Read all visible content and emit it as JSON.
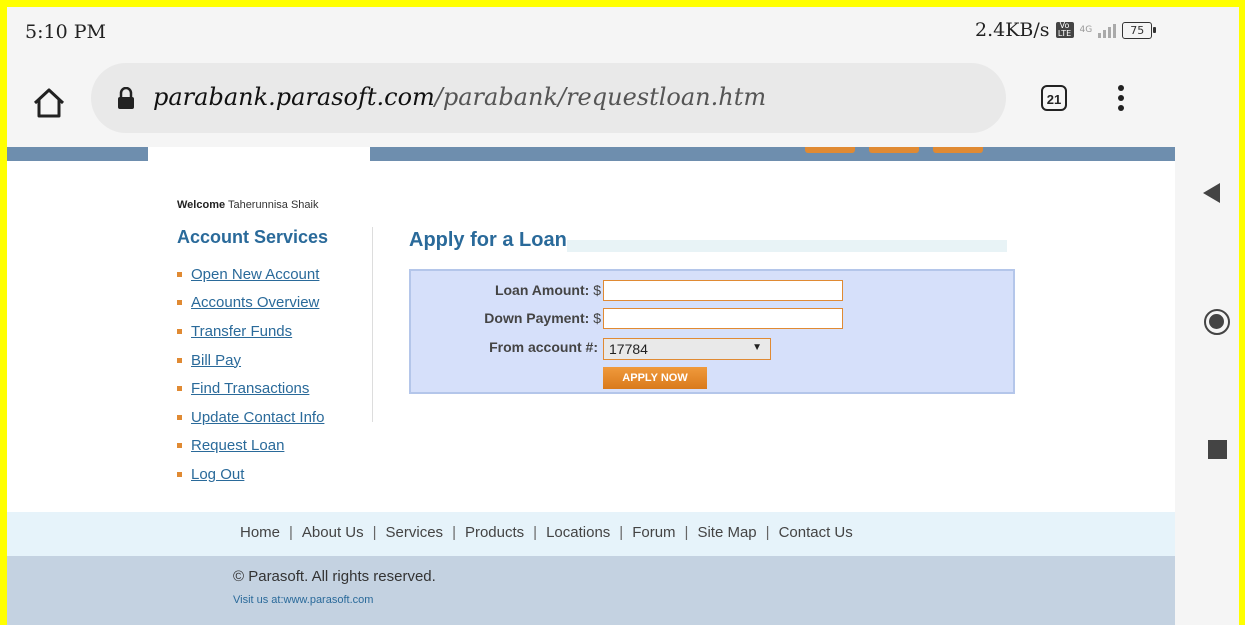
{
  "status_bar": {
    "time": "5:10 PM",
    "network_speed": "2.4KB/s",
    "volte": "Vo LTE",
    "signal_label": "4G",
    "battery": "75"
  },
  "browser": {
    "url_host": "parabank.parasoft.com",
    "url_path": "/parabank/requestloan.htm",
    "tab_count": "21"
  },
  "sidebar": {
    "welcome_prefix": "Welcome",
    "user_name": "Taherunnisa Shaik",
    "title": "Account Services",
    "items": [
      {
        "label": "Open New Account"
      },
      {
        "label": "Accounts Overview"
      },
      {
        "label": "Transfer Funds"
      },
      {
        "label": "Bill Pay"
      },
      {
        "label": "Find Transactions"
      },
      {
        "label": "Update Contact Info"
      },
      {
        "label": "Request Loan"
      },
      {
        "label": "Log Out"
      }
    ]
  },
  "main": {
    "title": "Apply for a Loan",
    "form": {
      "loan_amount_label": "Loan Amount:",
      "down_payment_label": "Down Payment:",
      "currency": "$",
      "from_account_label": "From account #:",
      "loan_amount_value": "",
      "down_payment_value": "",
      "from_account_value": "17784",
      "apply_label": "APPLY NOW"
    }
  },
  "footer": {
    "links": [
      "Home",
      "About Us",
      "Services",
      "Products",
      "Locations",
      "Forum",
      "Site Map",
      "Contact Us"
    ],
    "separator": "|",
    "copyright": "© Parasoft. All rights reserved.",
    "visit": "Visit us at:www.parasoft.com"
  },
  "colors": {
    "frame": "#ffff00",
    "link_blue": "#2a6a9a",
    "accent_orange": "#e08a33",
    "form_bg": "#d6e0fa"
  }
}
